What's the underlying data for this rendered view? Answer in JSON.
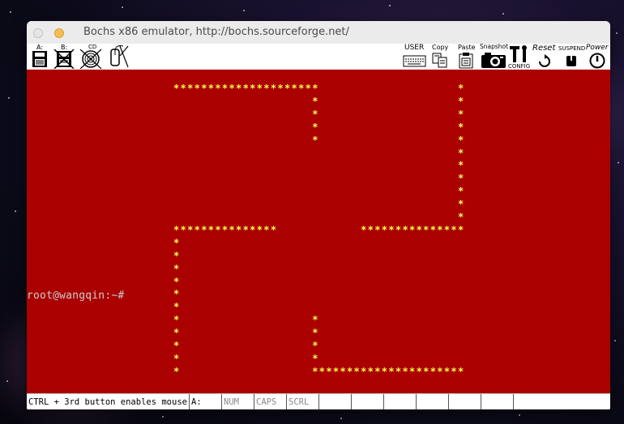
{
  "window": {
    "title": "Bochs x86 emulator, http://bochs.sourceforge.net/"
  },
  "toolbar": {
    "left_items": [
      {
        "label": "A:",
        "icon": "floppy-a-icon"
      },
      {
        "label": "B:",
        "icon": "floppy-b-icon"
      },
      {
        "label": "CD",
        "icon": "cdrom-icon"
      },
      {
        "label": "",
        "icon": "mouse-icon"
      }
    ],
    "right_items": [
      {
        "label": "USER",
        "icon": "keyboard-icon"
      },
      {
        "label": "Copy",
        "icon": "copy-icon"
      },
      {
        "label": "Paste",
        "icon": "paste-icon"
      },
      {
        "label": "Snapshot",
        "icon": "camera-icon"
      },
      {
        "label": "CONFIG",
        "icon": "config-icon"
      },
      {
        "label": "Reset",
        "icon": "reset-icon"
      },
      {
        "label": "SUSPEND",
        "icon": "suspend-icon"
      },
      {
        "label": "Power",
        "icon": "power-icon"
      }
    ]
  },
  "screen": {
    "prompt": "root@wangqin:~#",
    "pattern_char": "*",
    "text_color": "#ffff55",
    "background_color": "#aa0000"
  },
  "statusbar": {
    "message": "CTRL + 3rd button enables mouse",
    "drive": "A:",
    "num": "NUM",
    "caps": "CAPS",
    "scrl": "SCRL"
  }
}
